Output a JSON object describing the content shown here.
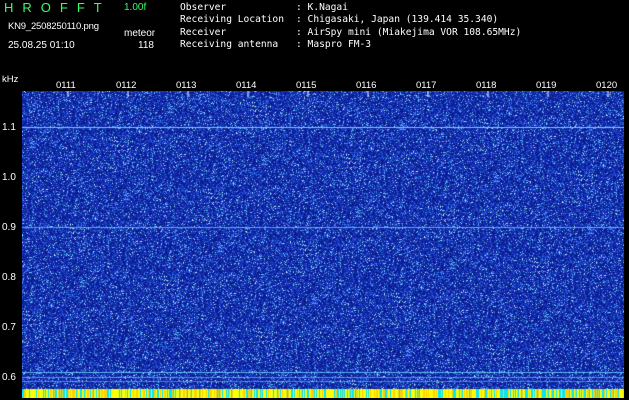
{
  "header": {
    "app_title": "HROFFT",
    "version": "1.00f",
    "filename": "KN9_2508250110.png",
    "mode": "meteor",
    "datetime": "25.08.25 01:10",
    "count": "118"
  },
  "info": [
    {
      "label": "Observer",
      "value": ": K.Nagai"
    },
    {
      "label": "Receiving Location",
      "value": ": Chigasaki, Japan (139.414 35.340)"
    },
    {
      "label": "Receiver",
      "value": ": AirSpy mini (Miakejima VOR 108.65MHz)"
    },
    {
      "label": "Receiving antenna",
      "value": ": Maspro FM-3"
    }
  ],
  "axis": {
    "y_unit": "kHz",
    "y_labels": [
      "1.1",
      "1.0",
      "0.9",
      "0.8",
      "0.7",
      "0.6"
    ],
    "x_labels": [
      "0111",
      "0112",
      "0113",
      "0114",
      "0115",
      "0116",
      "0117",
      "0118",
      "0119",
      "0120"
    ]
  },
  "colors": {
    "background": "#000000",
    "plot_bg": "#0a1a8c",
    "title_green": "#33ff66",
    "trace": "#6fd6ff",
    "bottom_bar": "#ffff00"
  }
}
